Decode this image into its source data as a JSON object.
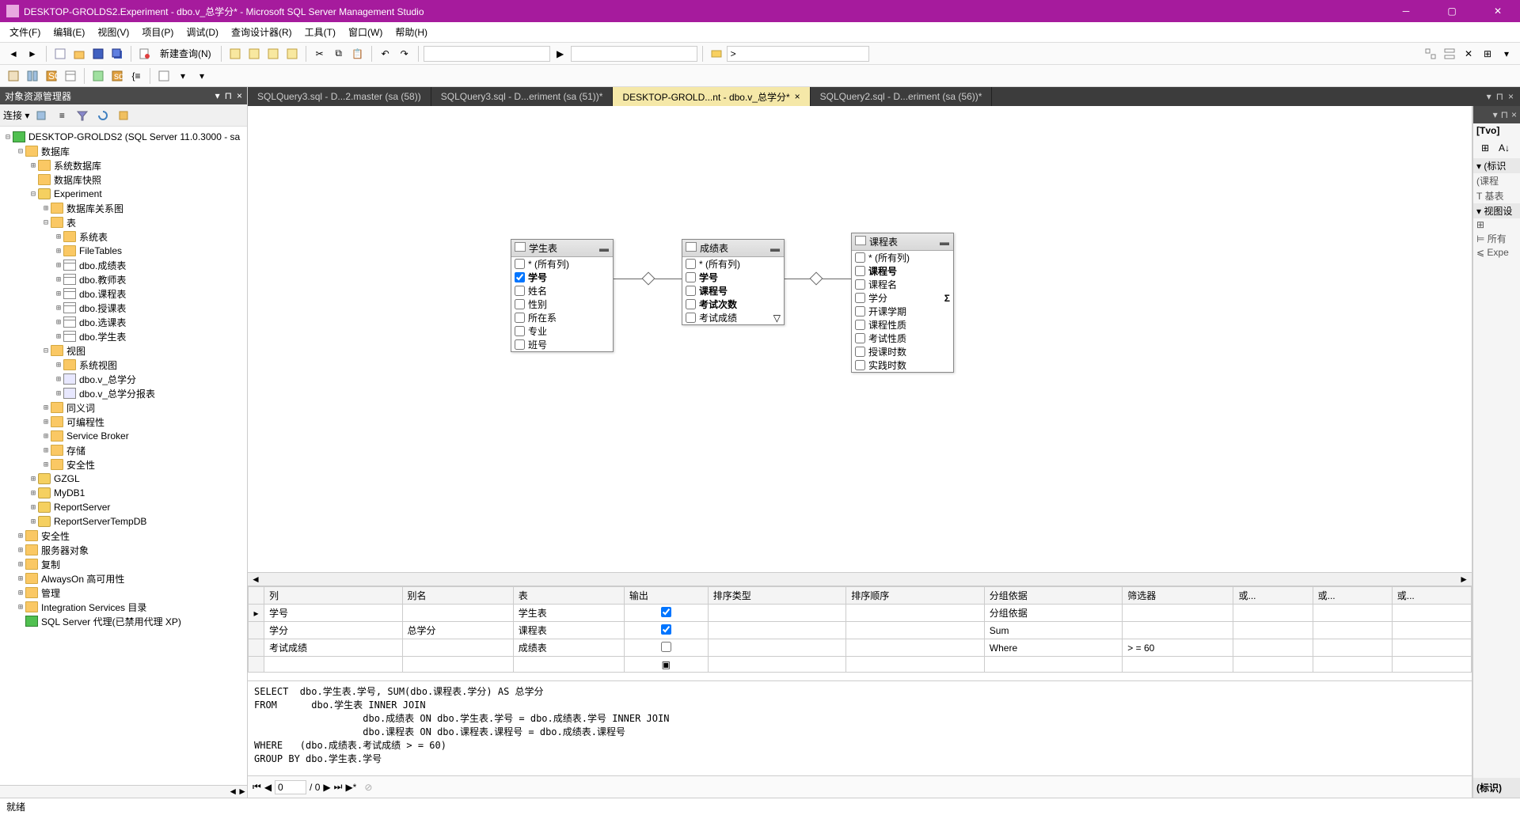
{
  "titlebar": {
    "title": "DESKTOP-GROLDS2.Experiment - dbo.v_总学分* - Microsoft SQL Server Management Studio"
  },
  "menu": {
    "items": [
      "文件(F)",
      "编辑(E)",
      "视图(V)",
      "项目(P)",
      "调试(D)",
      "查询设计器(R)",
      "工具(T)",
      "窗口(W)",
      "帮助(H)"
    ]
  },
  "toolbar1": {
    "newquery": "新建查询(N)",
    "combo_empty": ""
  },
  "toolbar2": {
    "gt": ">"
  },
  "objexplorer": {
    "title": "对象资源管理器",
    "connect": "连接 ▾",
    "root": "DESKTOP-GROLDS2 (SQL Server 11.0.3000 - sa",
    "nodes": {
      "db": "数据库",
      "sysdb": "系统数据库",
      "dbsnap": "数据库快照",
      "exp": "Experiment",
      "dbdiag": "数据库关系图",
      "tables": "表",
      "systab": "系统表",
      "filetab": "FileTables",
      "t1": "dbo.成绩表",
      "t2": "dbo.教师表",
      "t3": "dbo.课程表",
      "t4": "dbo.授课表",
      "t5": "dbo.选课表",
      "t6": "dbo.学生表",
      "views": "视图",
      "sysview": "系统视图",
      "v1": "dbo.v_总学分",
      "v2": "dbo.v_总学分报表",
      "syn": "同义词",
      "prog": "可编程性",
      "sb": "Service Broker",
      "storage": "存储",
      "sec": "安全性",
      "gzgl": "GZGL",
      "mydb": "MyDB1",
      "rs": "ReportServer",
      "rstmp": "ReportServerTempDB",
      "sec2": "安全性",
      "srvobj": "服务器对象",
      "repl": "复制",
      "aoha": "AlwaysOn 高可用性",
      "mgmt": "管理",
      "intsvc": "Integration Services 目录",
      "agent": "SQL Server 代理(已禁用代理 XP)"
    }
  },
  "tabs": [
    {
      "label": "SQLQuery3.sql - D...2.master (sa (58))",
      "active": false
    },
    {
      "label": "SQLQuery3.sql - D...eriment (sa (51))*",
      "active": false
    },
    {
      "label": "DESKTOP-GROLD...nt - dbo.v_总学分*",
      "active": true
    },
    {
      "label": "SQLQuery2.sql - D...eriment (sa (56))*",
      "active": false
    }
  ],
  "diagram": {
    "t1": {
      "title": "学生表",
      "cols": [
        "* (所有列)",
        "学号",
        "姓名",
        "性别",
        "所在系",
        "专业",
        "班号"
      ],
      "checked": [
        false,
        true,
        false,
        false,
        false,
        false,
        false
      ]
    },
    "t2": {
      "title": "成绩表",
      "cols": [
        "* (所有列)",
        "学号",
        "课程号",
        "考试次数",
        "考试成绩"
      ],
      "checked": [
        false,
        false,
        false,
        false,
        false
      ]
    },
    "t3": {
      "title": "课程表",
      "cols": [
        "* (所有列)",
        "课程号",
        "课程名",
        "学分",
        "开课学期",
        "课程性质",
        "考试性质",
        "授课时数",
        "实践时数"
      ],
      "checked": [
        false,
        false,
        false,
        false,
        false,
        false,
        false,
        false,
        false
      ]
    }
  },
  "criteria": {
    "headers": [
      "列",
      "别名",
      "表",
      "输出",
      "排序类型",
      "排序顺序",
      "分组依据",
      "筛选器",
      "或...",
      "或...",
      "或..."
    ],
    "rows": [
      {
        "col": "学号",
        "alias": "",
        "table": "学生表",
        "output": true,
        "sorttype": "",
        "sortorder": "",
        "groupby": "分组依据",
        "filter": "",
        "or1": "",
        "or2": "",
        "or3": ""
      },
      {
        "col": "学分",
        "alias": "总学分",
        "table": "课程表",
        "output": true,
        "sorttype": "",
        "sortorder": "",
        "groupby": "Sum",
        "filter": "",
        "or1": "",
        "or2": "",
        "or3": ""
      },
      {
        "col": "考试成绩",
        "alias": "",
        "table": "成绩表",
        "output": false,
        "sorttype": "",
        "sortorder": "",
        "groupby": "Where",
        "filter": "> = 60",
        "or1": "",
        "or2": "",
        "or3": ""
      }
    ]
  },
  "sql": "SELECT  dbo.学生表.学号, SUM(dbo.课程表.学分) AS 总学分\nFROM      dbo.学生表 INNER JOIN\n                   dbo.成绩表 ON dbo.学生表.学号 = dbo.成绩表.学号 INNER JOIN\n                   dbo.课程表 ON dbo.课程表.课程号 = dbo.成绩表.课程号\nWHERE   (dbo.成绩表.考试成绩 > = 60)\nGROUP BY dbo.学生表.学号",
  "navbar": {
    "pos": "0",
    "of": "/ 0"
  },
  "proppanel": {
    "head": "[Tvo]",
    "p0": "(标识",
    "p1": "课程",
    "p2": "基表",
    "cat2": "视图设",
    "p3": "",
    "p4": "所有",
    "p5": "Expe",
    "foot": "(标识)"
  },
  "status": {
    "ready": "就绪"
  }
}
